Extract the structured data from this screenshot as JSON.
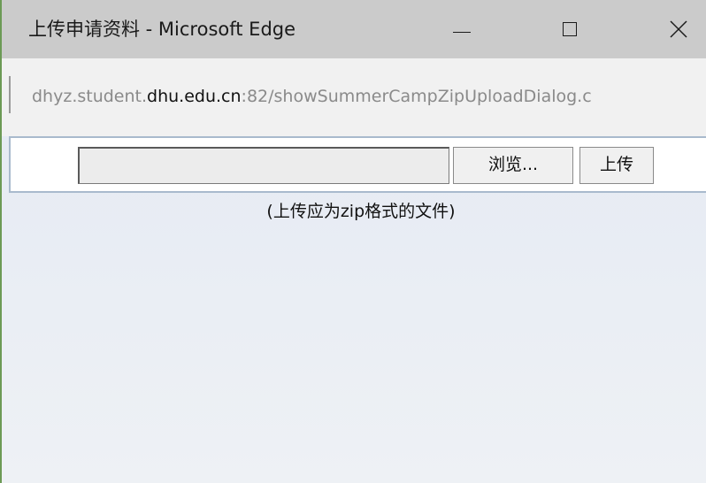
{
  "window": {
    "title": "上传申请资料 - Microsoft Edge",
    "controls": {
      "minimize": "minimize-icon",
      "maximize": "maximize-icon",
      "close": "close-icon"
    }
  },
  "address": {
    "url_prefix": "dhyz.student.",
    "url_host": "dhu.edu.cn",
    "url_suffix": ":82/showSummerCampZipUploadDialog.c"
  },
  "upload": {
    "file_path_value": "",
    "browse_label": "浏览...",
    "upload_label": "上传",
    "hint": "(上传应为zip格式的文件)"
  },
  "colors": {
    "titlebar_bg": "#cbcbcb",
    "addressbar_bg": "#f1f1f1",
    "content_bg": "#e6ebf3",
    "window_accent": "#6c9a55"
  }
}
